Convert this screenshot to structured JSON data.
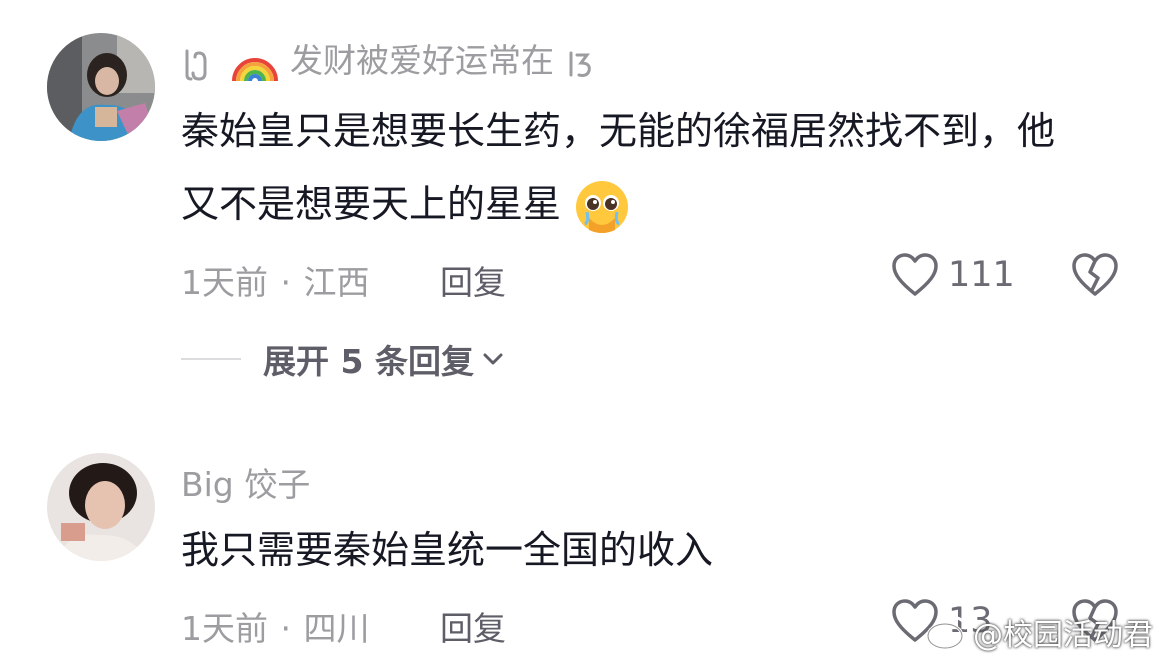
{
  "comments": [
    {
      "username": "发财被爱好运常在",
      "content": "秦始皇只是想要长生药，无能的徐福居然找不到，他又不是想要天上的星星",
      "time": "1天前",
      "location": "江西",
      "reply_label": "回复",
      "like_count": "111",
      "expand_label": "展开 5 条回复"
    },
    {
      "username": "Big 饺子",
      "content": "我只需要秦始皇统一全国的收入",
      "time": "1天前",
      "location": "四川",
      "reply_label": "回复",
      "like_count": "13"
    }
  ],
  "watermark": {
    "text": "@校园活动君"
  },
  "icons": {
    "like": "heart-outline-icon",
    "dislike": "broken-heart-icon",
    "expand": "chevron-down-icon",
    "emoji": "pleading-face-emoji",
    "username_deco": "rainbow-emoji"
  },
  "colors": {
    "primary_text": "#161823",
    "secondary_text": "#9c9ca1",
    "action_text": "#5d5e67"
  }
}
